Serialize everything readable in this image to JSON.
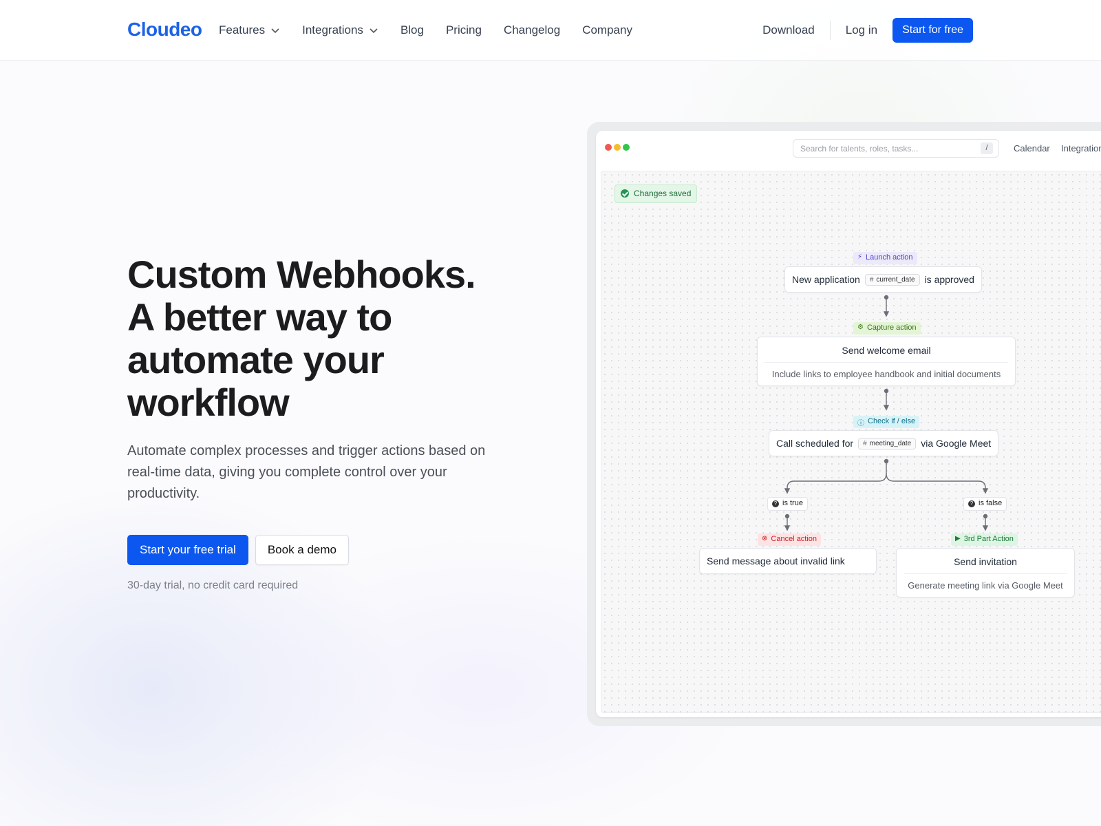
{
  "nav": {
    "logo": "Cloudeo",
    "links": [
      "Features",
      "Integrations",
      "Blog",
      "Pricing",
      "Changelog",
      "Company"
    ],
    "download": "Download",
    "login": "Log in",
    "cta": "Start for free"
  },
  "hero": {
    "title_lines": [
      "Custom Webhooks.",
      "A better way to",
      "automate your",
      "workflow"
    ],
    "subtitle": "Automate complex processes and trigger actions based on real-time data, giving you complete control over your productivity.",
    "primary_cta": "Start your free trial",
    "secondary_cta": "Book a demo",
    "note": "30-day trial, no credit card required"
  },
  "app": {
    "search_placeholder": "Search for talents, roles, tasks...",
    "search_shortcut": "/",
    "tabs": [
      "Calendar",
      "Integrations"
    ],
    "status": "Changes saved",
    "flow": {
      "launch_tag": "Launch action",
      "launch_pre": "New application",
      "launch_var": "current_date",
      "launch_post": "is approved",
      "capture_tag": "Capture action",
      "email_title": "Send welcome email",
      "email_body": "Include links to employee handbook and initial documents",
      "check_tag": "Check if / else",
      "call_pre": "Call scheduled for",
      "call_var": "meeting_date",
      "call_post": "via Google Meet",
      "true_label": "is true",
      "false_label": "is false",
      "cancel_tag": "Cancel action",
      "cancel_text": "Send message about invalid link",
      "third_tag": "3rd Part Action",
      "invite_title": "Send invitation",
      "invite_body": "Generate meeting link via Google Meet"
    }
  },
  "colors": {
    "brand": "#1d63e6",
    "primary_button": "#0b57f0",
    "window_dots": [
      "#ee5a52",
      "#f5bd2e",
      "#31c748"
    ]
  }
}
